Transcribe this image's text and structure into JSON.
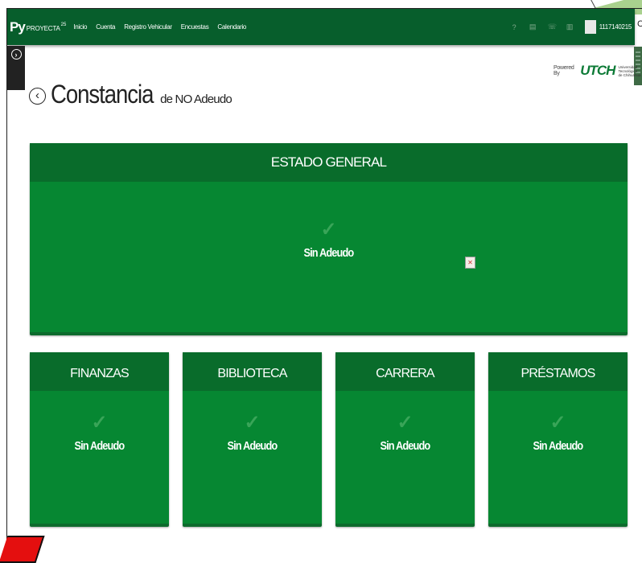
{
  "navbar": {
    "brand_py": "Py",
    "brand_name": "PROYECTA",
    "brand_sup": "25",
    "links": [
      "Inicio",
      "Cuenta",
      "Registro Vehicular",
      "Encuestas",
      "Calendario"
    ],
    "icons": [
      "help-icon",
      "document-icon",
      "phone-icon",
      "trash-icon"
    ],
    "user_id": "1117140215",
    "clipped_text": "C"
  },
  "page": {
    "title": "Constancia",
    "subtitle": "de NO Adeudo",
    "powered_by": "Powered By",
    "logo_text": "UTCH",
    "logo_caption": "Universidad Tecnológica de Chihuahua"
  },
  "general": {
    "header": "ESTADO GENERAL",
    "status": "Sin Adeudo"
  },
  "cards": [
    {
      "header": "FINANZAS",
      "status": "Sin Adeudo"
    },
    {
      "header": "BIBLIOTECA",
      "status": "Sin Adeudo"
    },
    {
      "header": "CARRERA",
      "status": "Sin Adeudo"
    },
    {
      "header": "PRÉSTAMOS",
      "status": "Sin Adeudo"
    }
  ],
  "colors": {
    "nav": "#075e2c",
    "panel": "#068732",
    "panel_header": "#096c2b",
    "check": "#39a558"
  }
}
